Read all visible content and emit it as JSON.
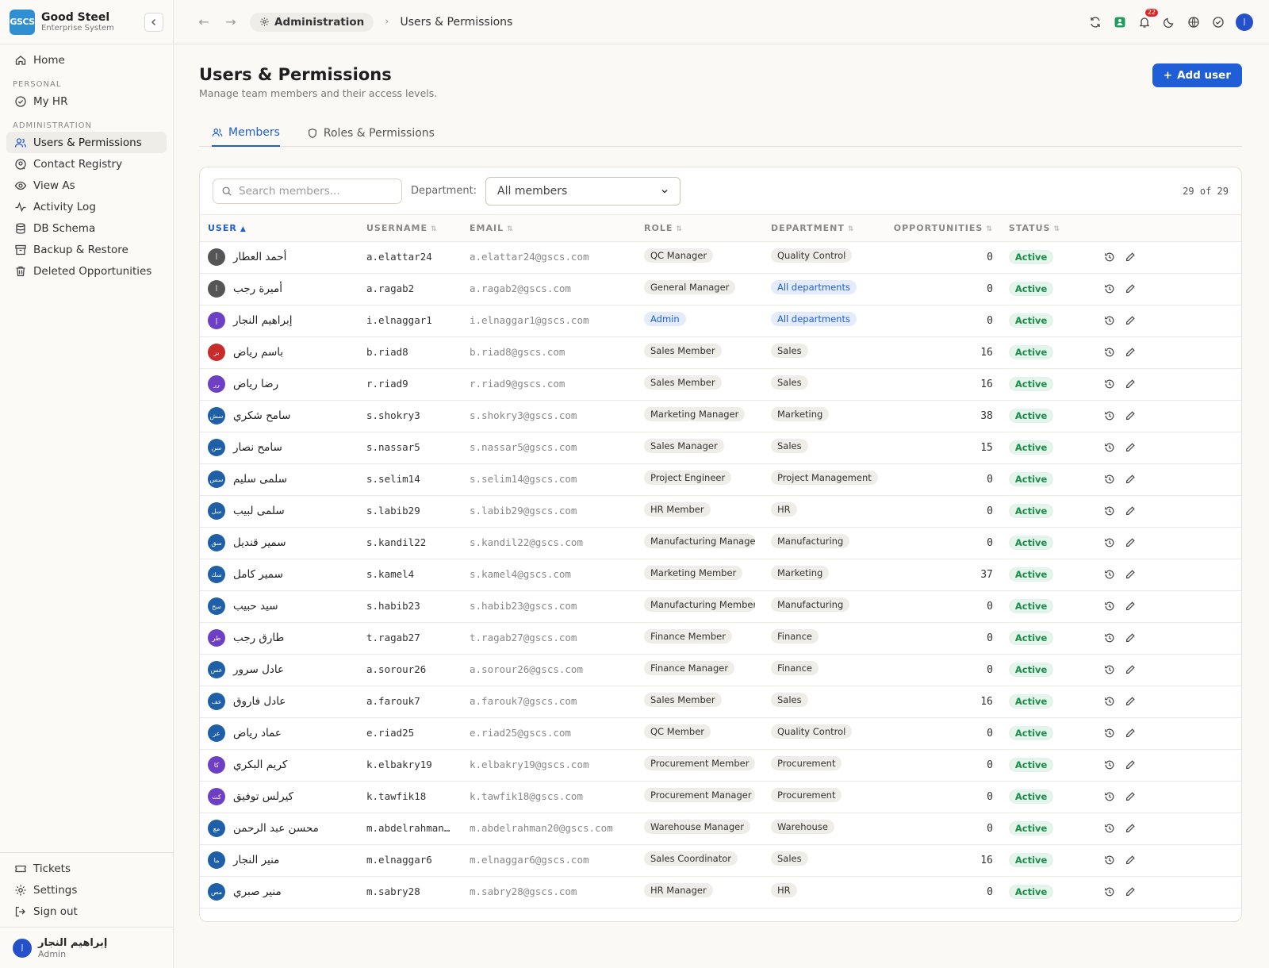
{
  "brand": {
    "logo": "GSCS",
    "name": "Good Steel",
    "subtitle": "Enterprise System"
  },
  "sidebar": {
    "home": "Home",
    "personal_label": "PERSONAL",
    "my_hr": "My HR",
    "admin_label": "ADMINISTRATION",
    "items": [
      {
        "label": "Users & Permissions",
        "icon": "users-icon"
      },
      {
        "label": "Contact Registry",
        "icon": "contact-icon"
      },
      {
        "label": "View As",
        "icon": "eye-icon"
      },
      {
        "label": "Activity Log",
        "icon": "activity-icon"
      },
      {
        "label": "DB Schema",
        "icon": "database-icon"
      },
      {
        "label": "Backup & Restore",
        "icon": "archive-icon"
      },
      {
        "label": "Deleted Opportunities",
        "icon": "trash-icon"
      }
    ],
    "bottom": [
      {
        "label": "Tickets",
        "icon": "ticket-icon"
      },
      {
        "label": "Settings",
        "icon": "gear-icon"
      },
      {
        "label": "Sign out",
        "icon": "signout-icon"
      }
    ],
    "profile": {
      "initials": "إ",
      "name": "إبراهيم النجار",
      "role": "Admin"
    }
  },
  "topbar": {
    "crumb_parent": "Administration",
    "crumb_current": "Users & Permissions",
    "notifications": "22",
    "avatar": "إ"
  },
  "page": {
    "title": "Users & Permissions",
    "subtitle": "Manage team members and their access levels.",
    "add_button": "Add user",
    "tabs": [
      "Members",
      "Roles & Permissions"
    ]
  },
  "filters": {
    "search_placeholder": "Search members...",
    "department_label": "Department:",
    "department_value": "All members",
    "count": "29 of 29"
  },
  "table": {
    "headers": [
      "USER",
      "USERNAME",
      "EMAIL",
      "ROLE",
      "DEPARTMENT",
      "OPPORTUNITIES",
      "STATUS"
    ],
    "rows": [
      {
        "av": "أ",
        "c": "#555",
        "name": "أحمد العطار",
        "user": "a.elattar24",
        "email": "a.elattar24@gscs.com",
        "role": "QC Manager",
        "dept": "Quality Control",
        "opp": "0",
        "status": "Active"
      },
      {
        "av": "أ",
        "c": "#555",
        "name": "أميرة رجب",
        "user": "a.ragab2",
        "email": "a.ragab2@gscs.com",
        "role": "General Manager",
        "dept": "All departments",
        "opp": "0",
        "status": "Active"
      },
      {
        "av": "إ",
        "c": "#6d3fc4",
        "name": "إبراهيم النجار",
        "user": "i.elnaggar1",
        "email": "i.elnaggar1@gscs.com",
        "role": "Admin",
        "dept": "All departments",
        "opp": "0",
        "status": "Active"
      },
      {
        "av": "بر",
        "c": "#c92a2a",
        "name": "باسم رياض",
        "user": "b.riad8",
        "email": "b.riad8@gscs.com",
        "role": "Sales Member",
        "dept": "Sales",
        "opp": "16",
        "status": "Active"
      },
      {
        "av": "رر",
        "c": "#6d3fc4",
        "name": "رضا رياض",
        "user": "r.riad9",
        "email": "r.riad9@gscs.com",
        "role": "Sales Member",
        "dept": "Sales",
        "opp": "16",
        "status": "Active"
      },
      {
        "av": "سش",
        "c": "#1e5fa8",
        "name": "سامح شكري",
        "user": "s.shokry3",
        "email": "s.shokry3@gscs.com",
        "role": "Marketing Manager",
        "dept": "Marketing",
        "opp": "38",
        "status": "Active"
      },
      {
        "av": "سن",
        "c": "#1e5fa8",
        "name": "سامح نصار",
        "user": "s.nassar5",
        "email": "s.nassar5@gscs.com",
        "role": "Sales Manager",
        "dept": "Sales",
        "opp": "15",
        "status": "Active"
      },
      {
        "av": "سس",
        "c": "#1e5fa8",
        "name": "سلمى سليم",
        "user": "s.selim14",
        "email": "s.selim14@gscs.com",
        "role": "Project Engineer",
        "dept": "Project Management",
        "opp": "0",
        "status": "Active"
      },
      {
        "av": "سل",
        "c": "#1e5fa8",
        "name": "سلمى لبيب",
        "user": "s.labib29",
        "email": "s.labib29@gscs.com",
        "role": "HR Member",
        "dept": "HR",
        "opp": "0",
        "status": "Active"
      },
      {
        "av": "سق",
        "c": "#1e5fa8",
        "name": "سمير قنديل",
        "user": "s.kandil22",
        "email": "s.kandil22@gscs.com",
        "role": "Manufacturing Manager",
        "dept": "Manufacturing",
        "opp": "0",
        "status": "Active"
      },
      {
        "av": "سك",
        "c": "#1e5fa8",
        "name": "سمير كامل",
        "user": "s.kamel4",
        "email": "s.kamel4@gscs.com",
        "role": "Marketing Member",
        "dept": "Marketing",
        "opp": "37",
        "status": "Active"
      },
      {
        "av": "سح",
        "c": "#1e5fa8",
        "name": "سيد حبيب",
        "user": "s.habib23",
        "email": "s.habib23@gscs.com",
        "role": "Manufacturing Member",
        "dept": "Manufacturing",
        "opp": "0",
        "status": "Active"
      },
      {
        "av": "طر",
        "c": "#6d3fc4",
        "name": "طارق رجب",
        "user": "t.ragab27",
        "email": "t.ragab27@gscs.com",
        "role": "Finance Member",
        "dept": "Finance",
        "opp": "0",
        "status": "Active"
      },
      {
        "av": "عس",
        "c": "#1e5fa8",
        "name": "عادل سرور",
        "user": "a.sorour26",
        "email": "a.sorour26@gscs.com",
        "role": "Finance Manager",
        "dept": "Finance",
        "opp": "0",
        "status": "Active"
      },
      {
        "av": "عف",
        "c": "#1e5fa8",
        "name": "عادل فاروق",
        "user": "a.farouk7",
        "email": "a.farouk7@gscs.com",
        "role": "Sales Member",
        "dept": "Sales",
        "opp": "16",
        "status": "Active"
      },
      {
        "av": "عر",
        "c": "#1e5fa8",
        "name": "عماد رياض",
        "user": "e.riad25",
        "email": "e.riad25@gscs.com",
        "role": "QC Member",
        "dept": "Quality Control",
        "opp": "0",
        "status": "Active"
      },
      {
        "av": "كا",
        "c": "#6d3fc4",
        "name": "كريم البكري",
        "user": "k.elbakry19",
        "email": "k.elbakry19@gscs.com",
        "role": "Procurement Member",
        "dept": "Procurement",
        "opp": "0",
        "status": "Active"
      },
      {
        "av": "كت",
        "c": "#6d3fc4",
        "name": "كيرلس توفيق",
        "user": "k.tawfik18",
        "email": "k.tawfik18@gscs.com",
        "role": "Procurement Manager",
        "dept": "Procurement",
        "opp": "0",
        "status": "Active"
      },
      {
        "av": "مع",
        "c": "#1e5fa8",
        "name": "محسن عبد الرحمن",
        "user": "m.abdelrahman…",
        "email": "m.abdelrahman20@gscs.com",
        "role": "Warehouse Manager",
        "dept": "Warehouse",
        "opp": "0",
        "status": "Active"
      },
      {
        "av": "ما",
        "c": "#1e5fa8",
        "name": "منير النجار",
        "user": "m.elnaggar6",
        "email": "m.elnaggar6@gscs.com",
        "role": "Sales Coordinator",
        "dept": "Sales",
        "opp": "16",
        "status": "Active"
      },
      {
        "av": "مص",
        "c": "#1e5fa8",
        "name": "منير صبري",
        "user": "m.sabry28",
        "email": "m.sabry28@gscs.com",
        "role": "HR Manager",
        "dept": "HR",
        "opp": "0",
        "status": "Active"
      }
    ]
  }
}
